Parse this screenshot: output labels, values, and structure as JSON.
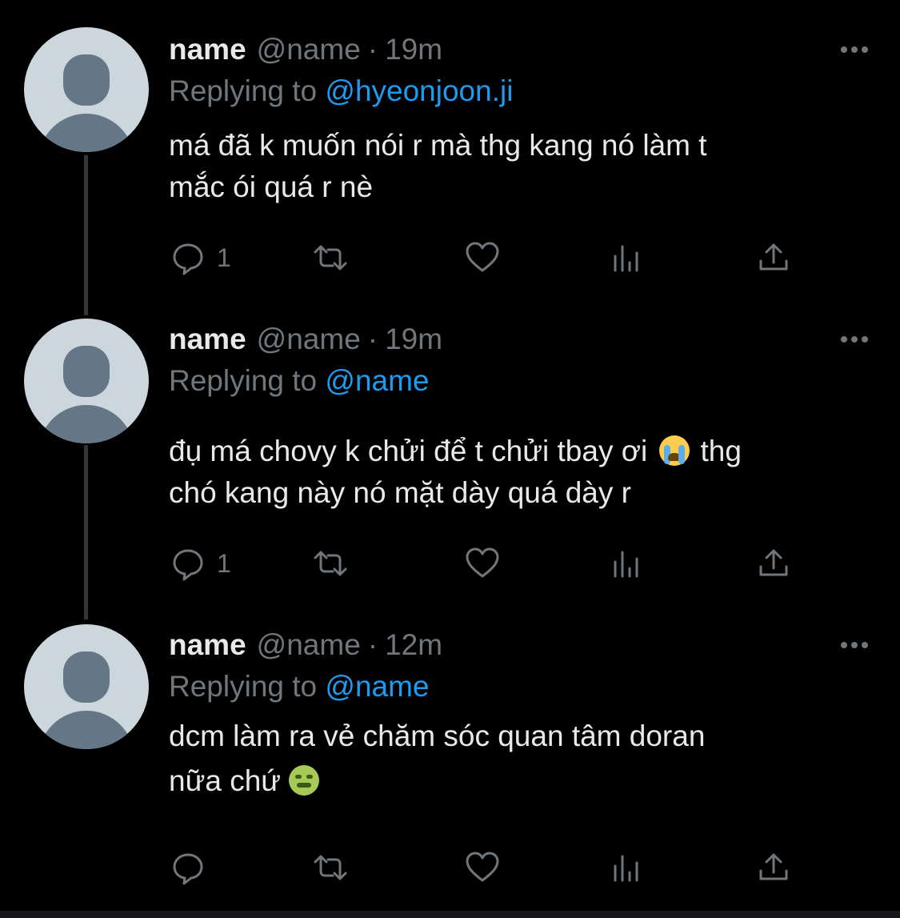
{
  "tweets": [
    {
      "name": "name",
      "handle": "@name",
      "separator": "·",
      "time": "19m",
      "replying_prefix": "Replying to",
      "replying_to": "@hyeonjoon.ji",
      "text": "má đã k muốn nói r mà thg kang nó làm t\nmắc ói quá r nè",
      "reply_count": "1",
      "icons": [
        "reply-icon",
        "retweet-icon",
        "like-icon",
        "views-icon",
        "share-icon",
        "more-icon"
      ]
    },
    {
      "name": "name",
      "handle": "@name",
      "separator": "·",
      "time": "19m",
      "replying_prefix": "Replying to",
      "replying_to": "@name",
      "text_part1": "đụ má chovy k chửi để t chửi tbay ơi",
      "emoji": "loudly-crying-face",
      "text_part2": "thg\nchó kang này nó mặt dày quá dày r",
      "reply_count": "1"
    },
    {
      "name": "name",
      "handle": "@name",
      "separator": "·",
      "time": "12m",
      "replying_prefix": "Replying to",
      "replying_to": "@name",
      "text_part1": "dcm làm ra vẻ chăm sóc quan tâm doran\nnữa chứ",
      "emoji": "nauseated-face",
      "reply_count": ""
    }
  ],
  "colors": {
    "background": "#000000",
    "primary_text": "#e7e9ea",
    "secondary_text": "#71767b",
    "link": "#1d9bf0",
    "avatar_bg": "#ccd6dd",
    "avatar_fg": "#657786"
  }
}
